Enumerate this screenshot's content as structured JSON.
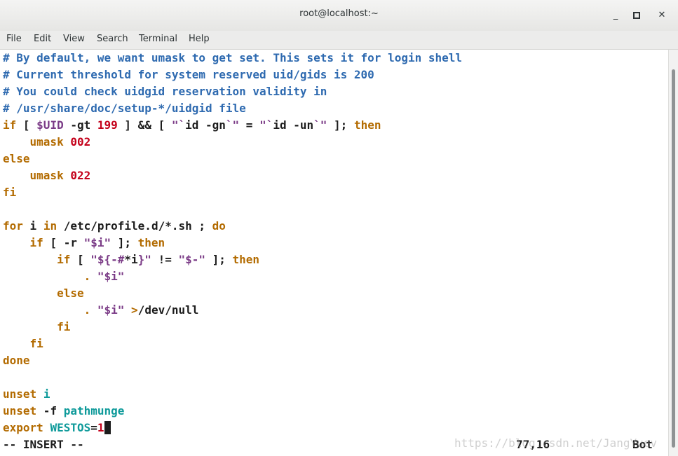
{
  "window": {
    "title": "root@localhost:~",
    "controls": [
      "minimize-icon",
      "maximize-icon",
      "close-icon"
    ]
  },
  "menu": [
    "File",
    "Edit",
    "View",
    "Search",
    "Terminal",
    "Help"
  ],
  "code": [
    [
      {
        "c": "cm",
        "t": "# By default, we want umask to get set. This sets it for login shell"
      }
    ],
    [
      {
        "c": "cm",
        "t": "# Current threshold for system reserved uid/gids is 200"
      }
    ],
    [
      {
        "c": "cm",
        "t": "# You could check uidgid reservation validity in"
      }
    ],
    [
      {
        "c": "cm",
        "t": "# /usr/share/doc/setup-*/uidgid file"
      }
    ],
    [
      {
        "c": "kw",
        "t": "if"
      },
      {
        "c": "txt",
        "t": " [ "
      },
      {
        "c": "str",
        "t": "$UID"
      },
      {
        "c": "txt",
        "t": " -gt "
      },
      {
        "c": "num",
        "t": "199"
      },
      {
        "c": "txt",
        "t": " ] && [ "
      },
      {
        "c": "str",
        "t": "\"`"
      },
      {
        "c": "txt",
        "t": "id -gn"
      },
      {
        "c": "str",
        "t": "`\""
      },
      {
        "c": "txt",
        "t": " = "
      },
      {
        "c": "str",
        "t": "\"`"
      },
      {
        "c": "txt",
        "t": "id -un"
      },
      {
        "c": "str",
        "t": "`\""
      },
      {
        "c": "txt",
        "t": " ]; "
      },
      {
        "c": "kw",
        "t": "then"
      }
    ],
    [
      {
        "c": "txt",
        "t": "    "
      },
      {
        "c": "kw",
        "t": "umask"
      },
      {
        "c": "txt",
        "t": " "
      },
      {
        "c": "num",
        "t": "002"
      }
    ],
    [
      {
        "c": "kw",
        "t": "else"
      }
    ],
    [
      {
        "c": "txt",
        "t": "    "
      },
      {
        "c": "kw",
        "t": "umask"
      },
      {
        "c": "txt",
        "t": " "
      },
      {
        "c": "num",
        "t": "022"
      }
    ],
    [
      {
        "c": "kw",
        "t": "fi"
      }
    ],
    [],
    [
      {
        "c": "kw",
        "t": "for"
      },
      {
        "c": "txt",
        "t": " i "
      },
      {
        "c": "kw",
        "t": "in"
      },
      {
        "c": "txt",
        "t": " /etc/profile.d/*.sh ; "
      },
      {
        "c": "kw",
        "t": "do"
      }
    ],
    [
      {
        "c": "txt",
        "t": "    "
      },
      {
        "c": "kw",
        "t": "if"
      },
      {
        "c": "txt",
        "t": " [ -r "
      },
      {
        "c": "str",
        "t": "\"$i\""
      },
      {
        "c": "txt",
        "t": " ]; "
      },
      {
        "c": "kw",
        "t": "then"
      }
    ],
    [
      {
        "c": "txt",
        "t": "        "
      },
      {
        "c": "kw",
        "t": "if"
      },
      {
        "c": "txt",
        "t": " [ "
      },
      {
        "c": "str",
        "t": "\"${-#"
      },
      {
        "c": "txt",
        "t": "*i"
      },
      {
        "c": "str",
        "t": "}\""
      },
      {
        "c": "txt",
        "t": " != "
      },
      {
        "c": "str",
        "t": "\"$-\""
      },
      {
        "c": "txt",
        "t": " ]; "
      },
      {
        "c": "kw",
        "t": "then"
      }
    ],
    [
      {
        "c": "txt",
        "t": "            "
      },
      {
        "c": "kw",
        "t": "."
      },
      {
        "c": "txt",
        "t": " "
      },
      {
        "c": "str",
        "t": "\"$i\""
      }
    ],
    [
      {
        "c": "txt",
        "t": "        "
      },
      {
        "c": "kw",
        "t": "else"
      }
    ],
    [
      {
        "c": "txt",
        "t": "            "
      },
      {
        "c": "kw",
        "t": "."
      },
      {
        "c": "txt",
        "t": " "
      },
      {
        "c": "str",
        "t": "\"$i\""
      },
      {
        "c": "txt",
        "t": " "
      },
      {
        "c": "kw",
        "t": ">"
      },
      {
        "c": "txt",
        "t": "/dev/null"
      }
    ],
    [
      {
        "c": "txt",
        "t": "        "
      },
      {
        "c": "kw",
        "t": "fi"
      }
    ],
    [
      {
        "c": "txt",
        "t": "    "
      },
      {
        "c": "kw",
        "t": "fi"
      }
    ],
    [
      {
        "c": "kw",
        "t": "done"
      }
    ],
    [],
    [
      {
        "c": "kw",
        "t": "unset"
      },
      {
        "c": "txt",
        "t": " "
      },
      {
        "c": "id",
        "t": "i"
      }
    ],
    [
      {
        "c": "kw",
        "t": "unset"
      },
      {
        "c": "txt",
        "t": " -f "
      },
      {
        "c": "id",
        "t": "pathmunge"
      }
    ],
    [
      {
        "c": "kw",
        "t": "export"
      },
      {
        "c": "txt",
        "t": " "
      },
      {
        "c": "id",
        "t": "WESTOS"
      },
      {
        "c": "txt",
        "t": "="
      },
      {
        "c": "num",
        "t": "1"
      },
      {
        "c": "cursor",
        "t": " "
      }
    ]
  ],
  "status": {
    "mode": "-- INSERT --",
    "position": "77,16",
    "scroll": "Bot"
  },
  "watermark": "https://blog.csdn.net/JangYuev",
  "colors": {
    "comment": "#2e6ab0",
    "keyword": "#b36b00",
    "number": "#c4001a",
    "string": "#7a3a86",
    "identifier": "#0e9a9a"
  }
}
